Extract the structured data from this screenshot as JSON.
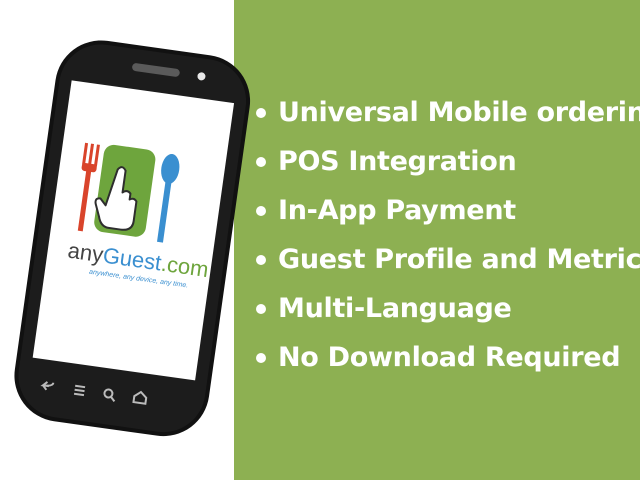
{
  "brand": {
    "name_any": "any",
    "name_guest": "Guest",
    "name_com": ".com",
    "tagline": "anywhere, any device, any time."
  },
  "features": [
    "Universal Mobile ordering",
    "POS Integration",
    "In-App Payment",
    "Guest Profile and Metrics",
    "Multi-Language",
    "No Download Required"
  ],
  "colors": {
    "panel_green": "#8db052",
    "logo_green": "#6ea53d",
    "fork_red": "#d9442b",
    "spoon_blue": "#3a8fd0",
    "phone_body": "#111111",
    "text_white": "#ffffff"
  },
  "icons": {
    "phone_buttons": [
      "back-icon",
      "menu-icon",
      "search-icon",
      "home-icon"
    ]
  }
}
